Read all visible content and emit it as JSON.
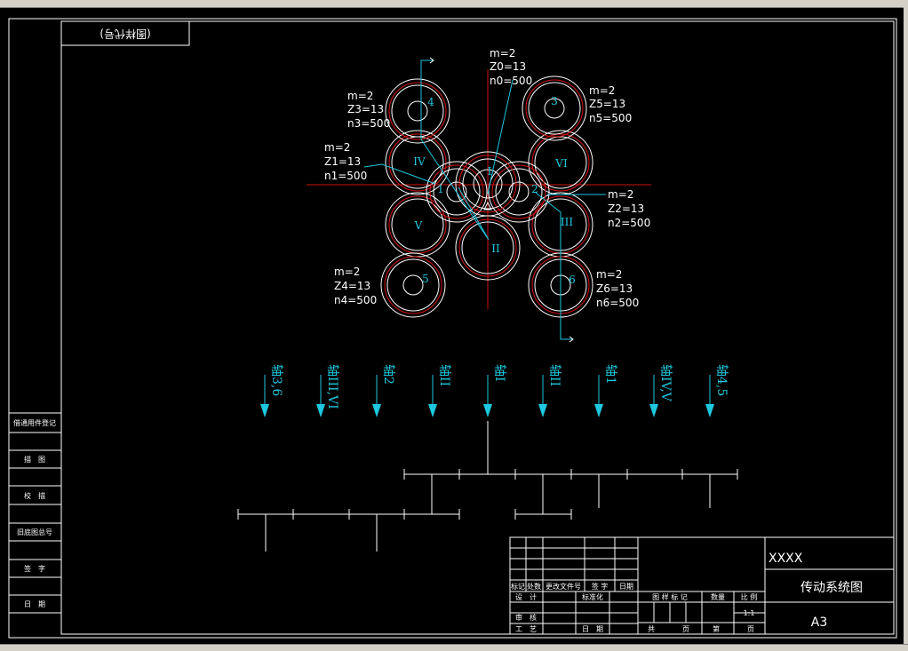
{
  "colors": {
    "background": "#000000",
    "line": "#ffffff",
    "center_line": "#d01010",
    "annotation": "#1ec8e0"
  },
  "title_tag": "(图样代号)",
  "left_panel": [
    "借通用件登记",
    "描　图",
    "校　描",
    "旧底图总号",
    "签　字",
    "日　期"
  ],
  "gears": [
    {
      "id": "IV",
      "roman": "IV"
    },
    {
      "id": "VI",
      "roman": "VI"
    },
    {
      "id": "V",
      "roman": "V"
    },
    {
      "id": "II",
      "roman": "II"
    },
    {
      "id": "III",
      "roman": "III"
    },
    {
      "id": "I",
      "roman": "I"
    },
    {
      "id": "1",
      "roman": "1"
    },
    {
      "id": "2",
      "roman": "2"
    },
    {
      "id": "3",
      "roman": "3"
    },
    {
      "id": "4",
      "roman": "4"
    },
    {
      "id": "5",
      "roman": "5"
    },
    {
      "id": "6",
      "roman": "6"
    }
  ],
  "gear_params": [
    [
      "m=2",
      "Z0=13",
      "n0=500"
    ],
    [
      "m=2",
      "Z3=13",
      "n3=500"
    ],
    [
      "m=2",
      "Z5=13",
      "n5=500"
    ],
    [
      "m=2",
      "Z1=13",
      "n1=500"
    ],
    [
      "m=2",
      "Z2=13",
      "n2=500"
    ],
    [
      "m=2",
      "Z4=13",
      "n4=500"
    ],
    [
      "m=2",
      "Z6=13",
      "n6=500"
    ]
  ],
  "shafts": [
    "轴3,6",
    "轴III,VI",
    "轴2",
    "轴II",
    "轴I",
    "轴II",
    "轴1",
    "轴IV,V",
    "轴4,5"
  ],
  "title_block": {
    "rev_headers": [
      "标记",
      "处数",
      "更改文件号",
      "签 字",
      "日期"
    ],
    "rows_left": [
      "设　计",
      "标准化",
      "审　核",
      "工　艺",
      "日　期"
    ],
    "mid_headers": [
      "图 样 标 记",
      "数量",
      "比 例"
    ],
    "scale": "1:1",
    "sheet_labels": [
      "共",
      "页",
      "第",
      "页"
    ],
    "company": "XXXX",
    "drawing_name": "传动系统图",
    "size": "A3"
  }
}
